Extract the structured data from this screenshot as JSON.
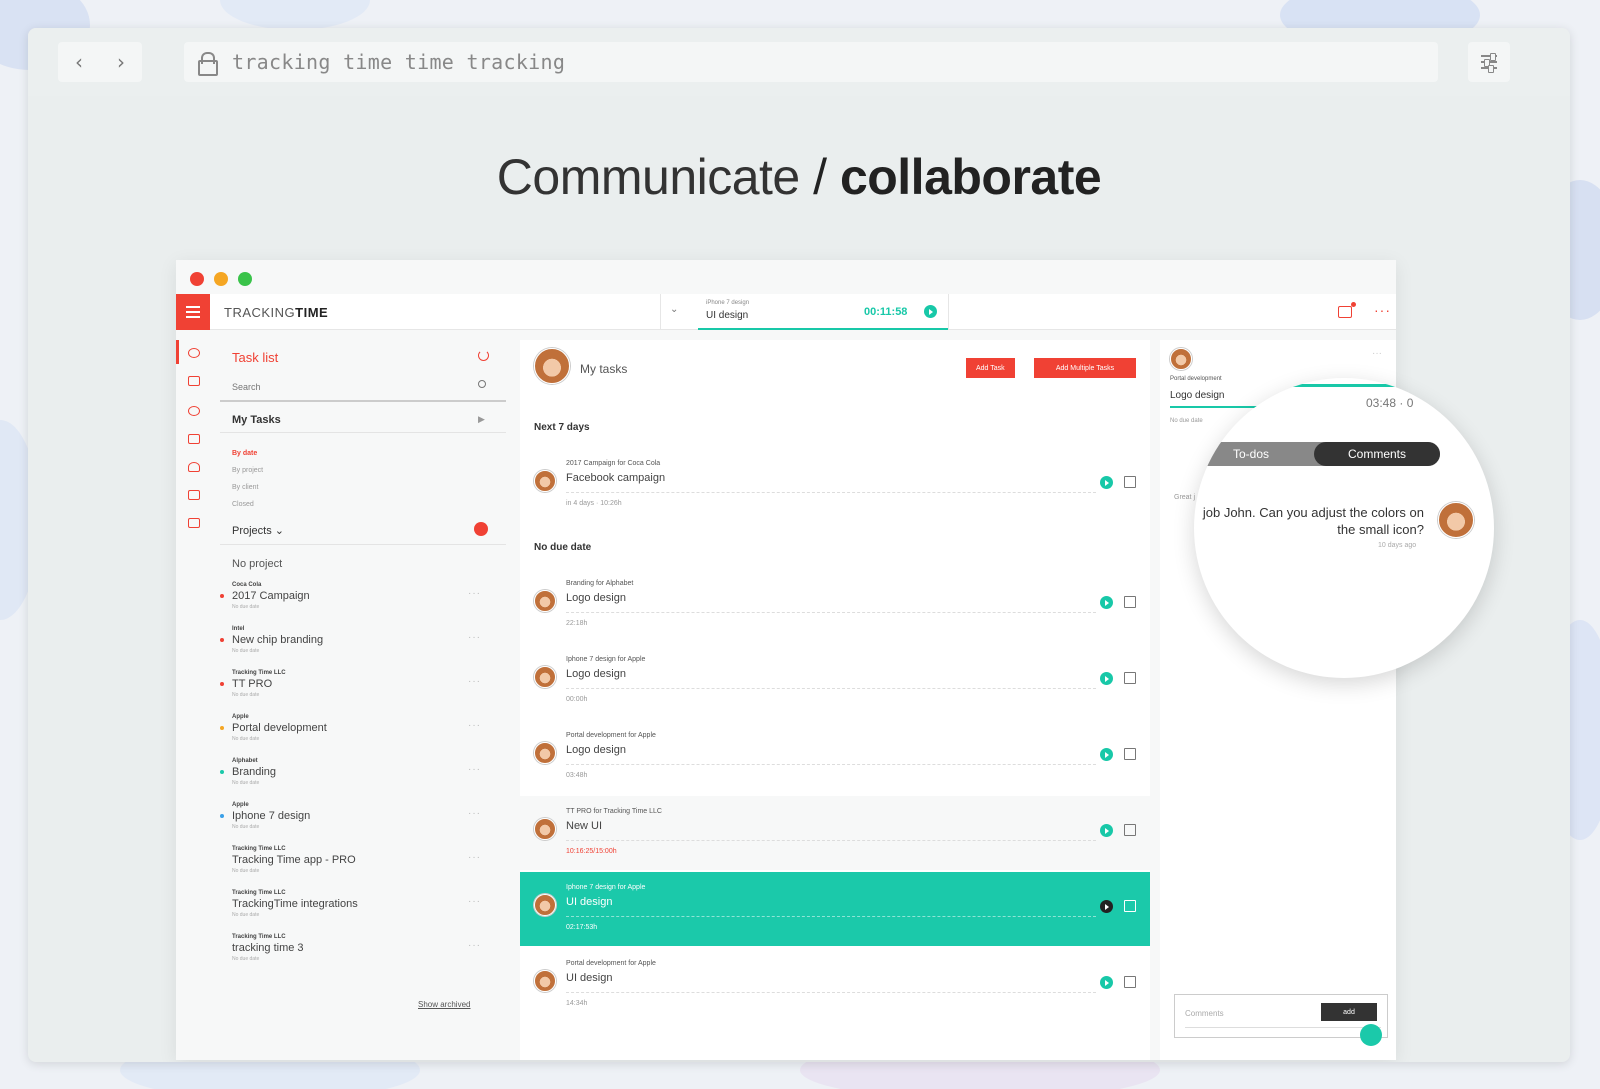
{
  "browser": {
    "url": "tracking time time tracking",
    "back_label": "‹",
    "forward_label": "›"
  },
  "headline": {
    "part1": "Communicate",
    "separator": " / ",
    "part2": "collaborate"
  },
  "app": {
    "logo_light": "TRACKING",
    "logo_bold": "TIME",
    "timer": {
      "project": "iPhone 7 design",
      "task": "UI design",
      "time": "00:11:58"
    },
    "colors": {
      "accent": "#f04134",
      "teal": "#1bc9aa"
    },
    "sidebar": {
      "title": "Task list",
      "search_placeholder": "Search",
      "my_tasks": "My Tasks",
      "filters": [
        "By date",
        "By project",
        "By client",
        "Closed"
      ],
      "projects_label": "Projects",
      "no_project": "No project",
      "projects": [
        {
          "client": "Coca Cola",
          "name": "2017 Campaign",
          "due": "No due date",
          "color": "#f04134"
        },
        {
          "client": "Intel",
          "name": "New chip branding",
          "due": "No due date",
          "color": "#f04134"
        },
        {
          "client": "Tracking Time LLC",
          "name": "TT PRO",
          "due": "No due date",
          "color": "#f04134"
        },
        {
          "client": "Apple",
          "name": "Portal development",
          "due": "No due date",
          "color": "#f5a623"
        },
        {
          "client": "Alphabet",
          "name": "Branding",
          "due": "No due date",
          "color": "#1bc9aa"
        },
        {
          "client": "Apple",
          "name": "Iphone 7 design",
          "due": "No due date",
          "color": "#3aa0e8"
        },
        {
          "client": "Tracking Time LLC",
          "name": "Tracking Time app - PRO",
          "due": "No due date",
          "color": ""
        },
        {
          "client": "Tracking Time LLC",
          "name": "TrackingTime integrations",
          "due": "No due date",
          "color": ""
        },
        {
          "client": "Tracking Time LLC",
          "name": "tracking time 3",
          "due": "No due date",
          "color": ""
        }
      ],
      "show_archived": "Show archived"
    },
    "main": {
      "title": "My tasks",
      "add_task": "Add Task",
      "add_multiple": "Add Multiple Tasks",
      "section_next": "Next 7 days",
      "section_nodue": "No due date",
      "tasks": [
        {
          "project": "2017 Campaign for Coca Cola",
          "name": "Facebook campaign",
          "meta": "in 4 days · 10:26h"
        },
        {
          "project": "Branding for Alphabet",
          "name": "Logo design",
          "meta": "22:18h"
        },
        {
          "project": "Iphone 7 design for Apple",
          "name": "Logo design",
          "meta": "00:00h"
        },
        {
          "project": "Portal development for Apple",
          "name": "Logo design",
          "meta": "03:48h"
        },
        {
          "project": "TT PRO for Tracking Time LLC",
          "name": "New UI",
          "meta": "10:16:25/15:00h"
        },
        {
          "project": "Iphone 7 design for Apple",
          "name": "UI design",
          "meta": "02:17:53h"
        },
        {
          "project": "Portal development for Apple",
          "name": "UI design",
          "meta": "14:34h"
        }
      ]
    },
    "detail": {
      "project": "Portal development",
      "task": "Logo design",
      "due": "No due date",
      "great": "Great j",
      "comment_placeholder": "Comments",
      "add_label": "add"
    },
    "magnifier": {
      "time": "03:48 · 0",
      "tab_todos": "To-dos",
      "tab_comments": "Comments",
      "comment": "job John. Can you adjust the colors on the small icon?",
      "ago": "10 days ago"
    }
  }
}
